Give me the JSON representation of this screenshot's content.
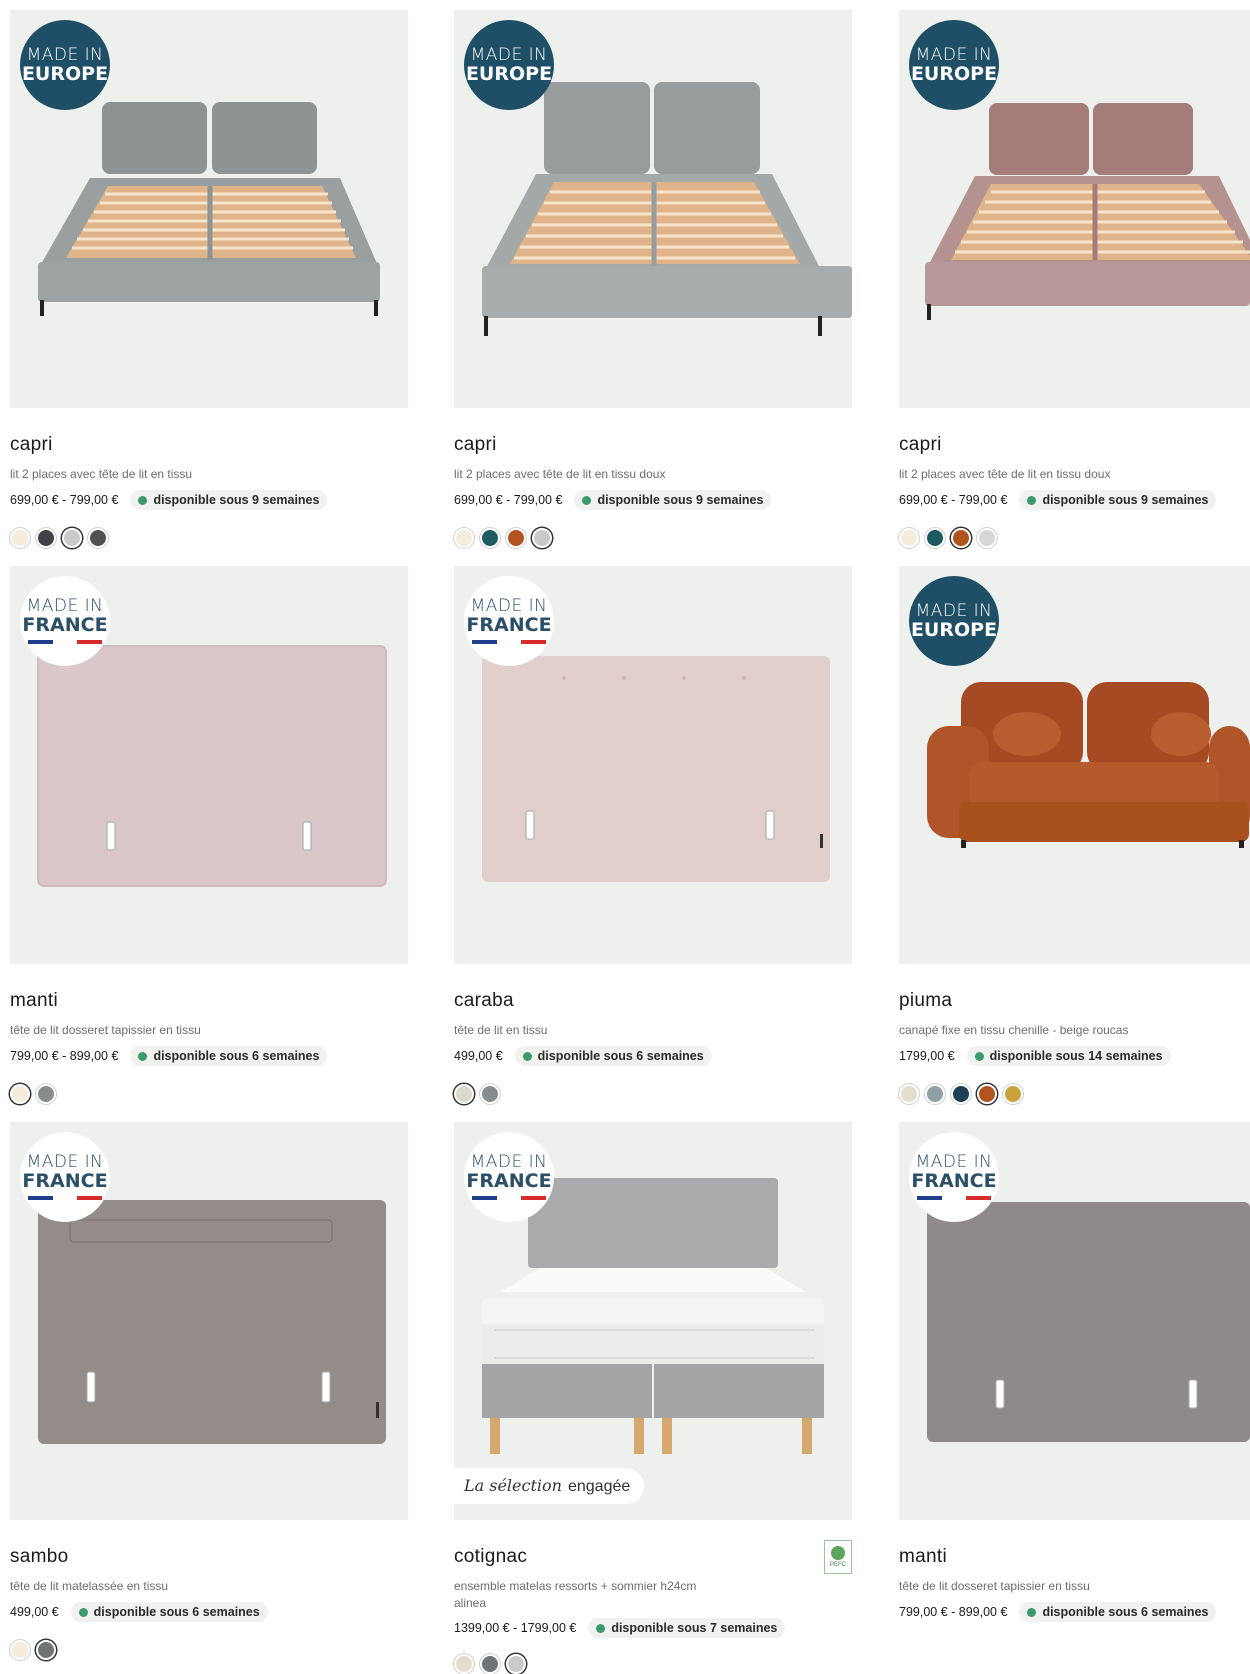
{
  "products": [
    {
      "name": "capri",
      "description": "lit 2 places avec tête de lit en tissu",
      "price": "699,00 € - 799,00 €",
      "availability": "disponible sous 9 semaines",
      "badge": {
        "line1": "MADE IN",
        "line2": "EUROPE",
        "type": "europe"
      },
      "image": "bed-capri-grey",
      "swatches": [
        "#f5eddc",
        "#3f4248",
        "#c8cacb",
        "#4e5250"
      ]
    },
    {
      "name": "capri",
      "description": "lit 2 places avec tête de lit en tissu doux",
      "price": "699,00 € - 799,00 €",
      "availability": "disponible sous 9 semaines",
      "badge": {
        "line1": "MADE IN",
        "line2": "EUROPE",
        "type": "europe"
      },
      "image": "bed-capri-lightgrey",
      "swatches": [
        "#f5eddc",
        "#1d5a62",
        "#b1531c",
        "#c8cacb"
      ]
    },
    {
      "name": "capri",
      "description": "lit 2 places avec tête de lit en tissu doux",
      "price": "699,00 € - 799,00 €",
      "availability": "disponible sous 9 semaines",
      "badge": {
        "line1": "MADE IN",
        "line2": "EUROPE",
        "type": "europe"
      },
      "image": "bed-capri-pink",
      "swatches": [
        "#f5eddc",
        "#1d5a62",
        "#b1531c",
        "#d5d7d8"
      ]
    },
    {
      "name": "manti",
      "description": "tête de lit dosseret tapissier en tissu",
      "price": "799,00 € - 899,00 €",
      "availability": "disponible sous 6 semaines",
      "badge": {
        "line1": "MADE IN",
        "line2": "FRANCE",
        "type": "france"
      },
      "image": "headboard-manti-pink",
      "swatches": [
        "#f5eddc",
        "#878c8e"
      ]
    },
    {
      "name": "caraba",
      "description": "tête de lit en tissu",
      "price": "499,00 €",
      "availability": "disponible sous 6 semaines",
      "badge": {
        "line1": "MADE IN",
        "line2": "FRANCE",
        "type": "france"
      },
      "image": "headboard-caraba-pink",
      "swatches": [
        "#ddd8cc",
        "#878c8e"
      ]
    },
    {
      "name": "piuma",
      "description": "canapé fixe en tissu chenille - beige roucas",
      "price": "1799,00 €",
      "availability": "disponible sous 14 semaines",
      "badge": {
        "line1": "MADE IN",
        "line2": "EUROPE",
        "type": "europe"
      },
      "image": "sofa-piuma-rust",
      "swatches": [
        "#e3ddcc",
        "#8ea0a5",
        "#1c3f55",
        "#b1531c",
        "#c9a23a"
      ]
    },
    {
      "name": "sambo",
      "description": "tête de lit matelassée en tissu",
      "price": "499,00 €",
      "availability": "disponible sous 6 semaines",
      "badge": {
        "line1": "MADE IN",
        "line2": "FRANCE",
        "type": "france"
      },
      "image": "headboard-sambo-taupe",
      "swatches": [
        "#f5eddc",
        "#6f7476"
      ]
    },
    {
      "name": "cotignac",
      "description": "ensemble matelas ressorts + sommier h24cm",
      "subdescription": "alinea",
      "price": "1399,00 € - 1799,00 €",
      "availability": "disponible sous 7 semaines",
      "badge": {
        "line1": "MADE IN",
        "line2": "FRANCE",
        "type": "france"
      },
      "image": "bed-cotignac-set",
      "selection_script": "La sélection",
      "selection_label": "engagée",
      "pefc_label": "PEFC",
      "swatches": [
        "#e3ddcc",
        "#6f7476",
        "#c8cacb"
      ]
    },
    {
      "name": "manti",
      "description": "tête de lit dosseret tapissier en tissu",
      "price": "799,00 € - 899,00 €",
      "availability": "disponible sous 6 semaines",
      "badge": {
        "line1": "MADE IN",
        "line2": "FRANCE",
        "type": "france"
      },
      "image": "headboard-manti-taupe",
      "swatches": []
    }
  ],
  "colors": {
    "availability_dot": "#3a9a6b",
    "europe_badge": "#1e4f66",
    "france_blue": "#1f3e8c",
    "france_red": "#d62b2b",
    "image_bg": "#eef0ed"
  }
}
